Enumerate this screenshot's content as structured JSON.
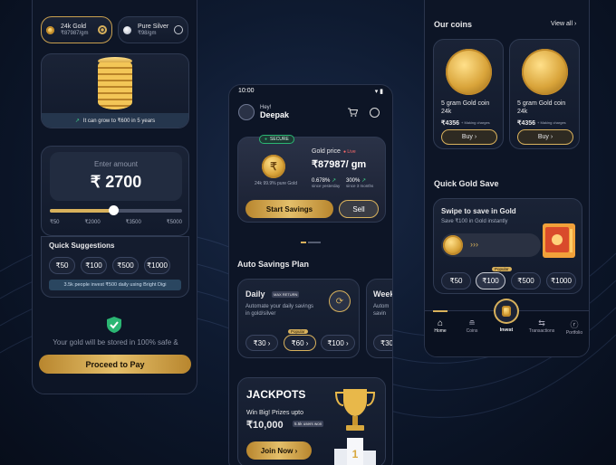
{
  "left": {
    "tab_gold": {
      "title": "24k Gold",
      "price": "₹87987/gm"
    },
    "tab_silver": {
      "title": "Pure Silver",
      "price": "₹98/gm"
    },
    "grow_text": "It can grow to ₹600 in 5 years",
    "enter_amount": "Enter amount",
    "amount": "₹ 2700",
    "slider_ticks": [
      "₹50",
      "₹2000",
      "₹3500",
      "₹5000"
    ],
    "slider_level": 0.48,
    "quick_title": "Quick Suggestions",
    "quick": [
      "₹50",
      "₹100",
      "₹500",
      "₹1000"
    ],
    "invest_note": "3.5k people invest ₹500 daily using Bright Digi",
    "safe_text": "Your gold will be stored in 100% safe & secure locker",
    "proceed": "Proceed to Pay"
  },
  "center": {
    "time": "10:00",
    "greeting": "Hey!",
    "name": "Deepak",
    "secure": "SECURE",
    "gold_price_label": "Gold price",
    "live": "Live",
    "price": "₹87987/ gm",
    "purity": "24k 99.9% pure Gold",
    "stat1": {
      "value": "0.678%",
      "label": "since yesterday"
    },
    "stat2": {
      "value": "300%",
      "label": "since 3 months"
    },
    "start_btn": "Start Savings",
    "sell_btn": "Sell",
    "auto_title": "Auto Savings Plan",
    "daily": {
      "title": "Daily",
      "badge": "MAX RETURN",
      "desc": "Automate your daily savings in gold/silver",
      "popular": "Popular",
      "amounts": [
        "₹30",
        "₹60",
        "₹100"
      ]
    },
    "weekly": {
      "title": "Week",
      "desc": "Autom savin",
      "amount": "₹30"
    },
    "jackpots": {
      "title": "JACKPOTS",
      "sub": "Win Big! Prizes upto",
      "prize": "₹10,000",
      "tag": "5.5k users won",
      "btn": "Join Now"
    }
  },
  "right": {
    "coins_title": "Our coins",
    "view_all": "View all",
    "coins": [
      {
        "name": "5 gram Gold coin",
        "karat": "24k",
        "price": "₹4356",
        "note": "+ Making charges",
        "buy": "Buy"
      },
      {
        "name": "5 gram Gold coin",
        "karat": "24k",
        "price": "₹4356",
        "note": "+ Making charges",
        "buy": "Buy"
      }
    ],
    "quick_save": "Quick Gold Save",
    "swipe_title": "Swipe to save in Gold",
    "swipe_sub": "Save ₹100 in Gold instantly",
    "popular": "Popular",
    "amounts": [
      "₹50",
      "₹100",
      "₹500",
      "₹1000"
    ],
    "nav": [
      "Home",
      "Coins",
      "Invest",
      "Transactions",
      "Portfolio"
    ]
  },
  "colors": {
    "gold": "#d8b15c",
    "bg": "#0e1a30",
    "green": "#3fd18a"
  }
}
